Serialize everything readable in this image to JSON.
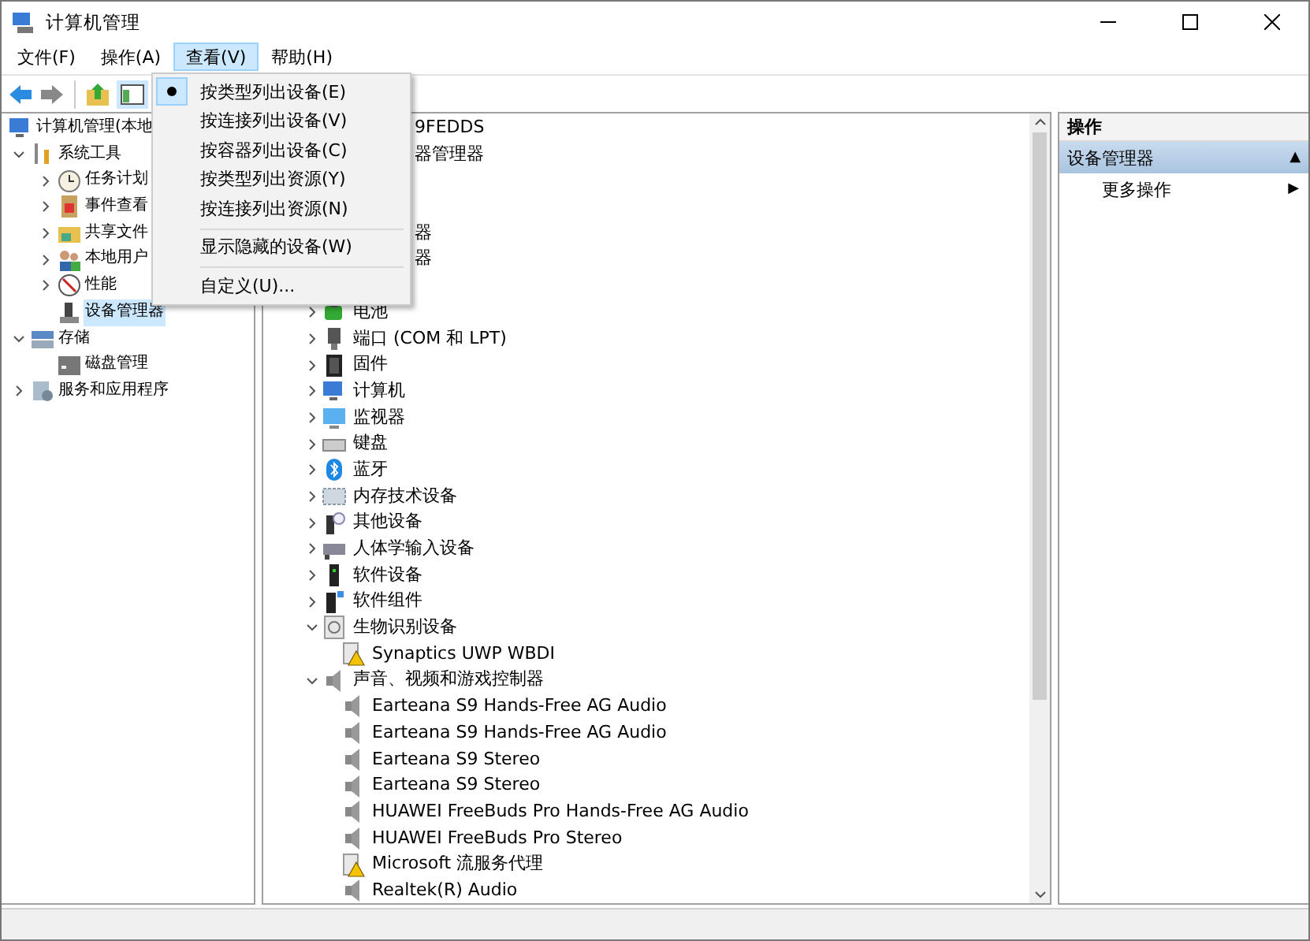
{
  "window": {
    "title": "计算机管理"
  },
  "menu_bar": [
    {
      "label": "文件(F)",
      "selected": false
    },
    {
      "label": "操作(A)",
      "selected": false
    },
    {
      "label": "查看(V)",
      "selected": true
    },
    {
      "label": "帮助(H)",
      "selected": false
    }
  ],
  "view_menu": [
    {
      "kind": "radio",
      "label": "按类型列出设备(E)",
      "checked": true
    },
    {
      "kind": "radio",
      "label": "按连接列出设备(V)",
      "checked": false
    },
    {
      "kind": "radio",
      "label": "按容器列出设备(C)",
      "checked": false
    },
    {
      "kind": "radio",
      "label": "按类型列出资源(Y)",
      "checked": false
    },
    {
      "kind": "radio",
      "label": "按连接列出资源(N)",
      "checked": false
    },
    {
      "kind": "separator"
    },
    {
      "kind": "check",
      "label": "显示隐藏的设备(W)",
      "checked": false
    },
    {
      "kind": "separator"
    },
    {
      "kind": "command",
      "label": "自定义(U)..."
    }
  ],
  "left_tree": [
    {
      "label": "计算机管理(本地",
      "selected": false,
      "children": [
        {
          "label": "系统工具",
          "expanded": true,
          "selected": false,
          "children": [
            {
              "label": "任务计划",
              "expanded": false,
              "selected": false
            },
            {
              "label": "事件查看",
              "expanded": false,
              "selected": false
            },
            {
              "label": "共享文件",
              "expanded": false,
              "selected": false
            },
            {
              "label": "本地用户",
              "expanded": false,
              "selected": false
            },
            {
              "label": "性能",
              "expanded": false,
              "selected": false
            },
            {
              "label": "设备管理器",
              "selected": true
            }
          ]
        },
        {
          "label": "存储",
          "expanded": true,
          "selected": false,
          "children": [
            {
              "label": "磁盘管理",
              "selected": false
            }
          ]
        },
        {
          "label": "服务和应用程序",
          "expanded": false,
          "selected": false
        }
      ]
    }
  ],
  "device_tree": {
    "clipped_rows": [
      "9FEDDS",
      "器管理器",
      "器",
      "器"
    ],
    "categories": [
      {
        "label": "电池",
        "expanded": false
      },
      {
        "label": "端口 (COM 和 LPT)",
        "expanded": false
      },
      {
        "label": "固件",
        "expanded": false
      },
      {
        "label": "计算机",
        "expanded": false
      },
      {
        "label": "监视器",
        "expanded": false
      },
      {
        "label": "键盘",
        "expanded": false
      },
      {
        "label": "蓝牙",
        "expanded": false
      },
      {
        "label": "内存技术设备",
        "expanded": false
      },
      {
        "label": "其他设备",
        "expanded": false
      },
      {
        "label": "人体学输入设备",
        "expanded": false
      },
      {
        "label": "软件设备",
        "expanded": false
      },
      {
        "label": "软件组件",
        "expanded": false
      },
      {
        "label": "生物识别设备",
        "expanded": true,
        "children": [
          {
            "label": "Synaptics UWP WBDI",
            "warning": true
          }
        ]
      },
      {
        "label": "声音、视频和游戏控制器",
        "expanded": true,
        "children": [
          {
            "label": "Earteana S9 Hands-Free AG Audio",
            "warning": false
          },
          {
            "label": "Earteana S9 Hands-Free AG Audio",
            "warning": false
          },
          {
            "label": "Earteana S9 Stereo",
            "warning": false
          },
          {
            "label": "Earteana S9 Stereo",
            "warning": false
          },
          {
            "label": "HUAWEI FreeBuds Pro Hands-Free AG Audio",
            "warning": false
          },
          {
            "label": "HUAWEI FreeBuds Pro Stereo",
            "warning": false
          },
          {
            "label": "Microsoft 流服务代理",
            "warning": true
          },
          {
            "label": "Realtek(R) Audio",
            "warning": false
          }
        ]
      }
    ]
  },
  "actions_pane": {
    "title": "操作",
    "section": {
      "label": "设备管理器",
      "toggle": "▲"
    },
    "items": [
      {
        "label": "更多操作",
        "arrow": "▶"
      }
    ]
  }
}
